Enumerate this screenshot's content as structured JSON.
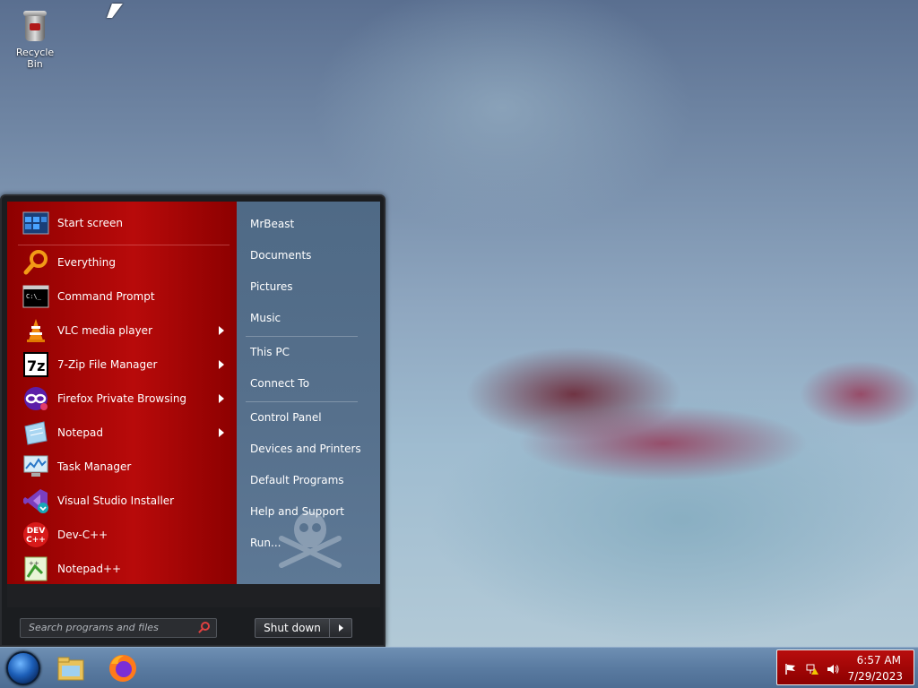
{
  "desktop": {
    "icons": [
      {
        "label": "Recycle Bin",
        "icon": "recycle-bin-icon"
      }
    ]
  },
  "start_menu": {
    "pinned": [
      {
        "label": "Start screen",
        "icon": "start-screen-icon",
        "submenu": false
      }
    ],
    "programs": [
      {
        "label": "Everything",
        "icon": "magnifier-icon",
        "submenu": false
      },
      {
        "label": "Command Prompt",
        "icon": "command-prompt-icon",
        "submenu": false
      },
      {
        "label": "VLC media player",
        "icon": "vlc-cone-icon",
        "submenu": true
      },
      {
        "label": "7-Zip File Manager",
        "icon": "7zip-icon",
        "submenu": true
      },
      {
        "label": "Firefox Private Browsing",
        "icon": "firefox-private-icon",
        "submenu": true
      },
      {
        "label": "Notepad",
        "icon": "notepad-icon",
        "submenu": true
      },
      {
        "label": "Task Manager",
        "icon": "task-manager-icon",
        "submenu": false
      },
      {
        "label": "Visual Studio Installer",
        "icon": "visual-studio-installer-icon",
        "submenu": false
      },
      {
        "label": "Dev-C++",
        "icon": "dev-cpp-icon",
        "submenu": false
      },
      {
        "label": "Notepad++",
        "icon": "notepadpp-icon",
        "submenu": false
      }
    ],
    "right_links": [
      "MrBeast",
      "Documents",
      "Pictures",
      "Music",
      "This PC",
      "Connect To",
      "Control Panel",
      "Devices and Printers",
      "Default Programs",
      "Help and Support",
      "Run..."
    ],
    "search": {
      "placeholder": "Search programs and files"
    },
    "shutdown_label": "Shut down"
  },
  "taskbar": {
    "pinned": [
      {
        "icon": "file-explorer-icon"
      },
      {
        "icon": "firefox-icon"
      }
    ],
    "tray": {
      "icons": [
        "action-center-flag-icon",
        "network-warning-icon",
        "volume-icon"
      ],
      "time": "6:57 AM",
      "date": "7/29/2023"
    }
  },
  "colors": {
    "menu_red": "#b80a0a",
    "menu_right": "#56708c",
    "taskbar": "#5a7ba1"
  }
}
